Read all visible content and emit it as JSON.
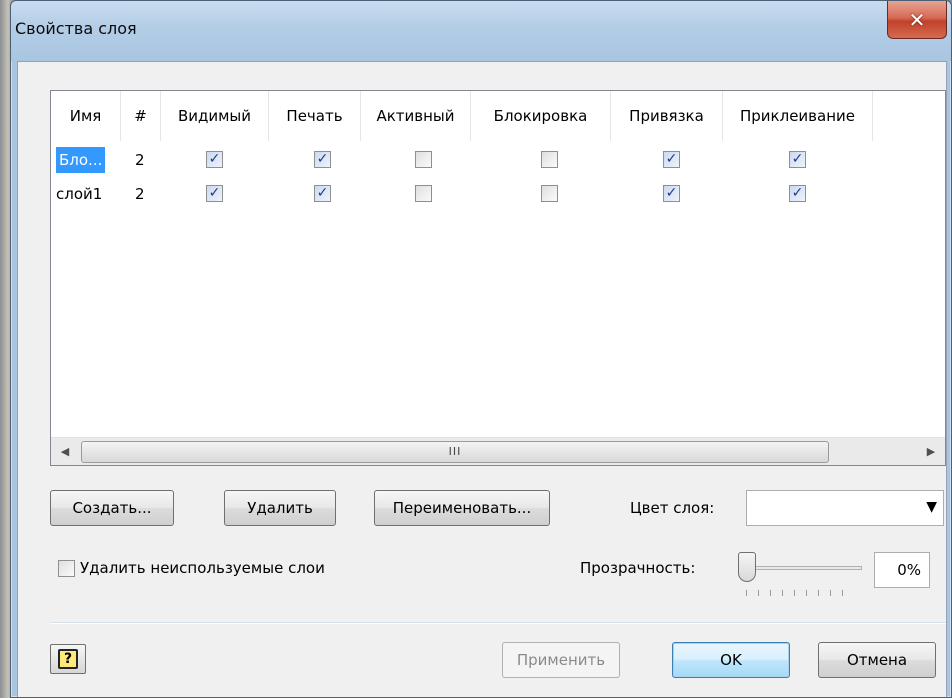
{
  "window": {
    "title": "Свойства слоя",
    "close_glyph": "✕"
  },
  "table": {
    "columns": [
      "Имя",
      "#",
      "Видимый",
      "Печать",
      "Активный",
      "Блокировка",
      "Привязка",
      "Приклеивание"
    ],
    "rows": [
      {
        "name": "Бло...",
        "count": "2",
        "visible": true,
        "print": true,
        "active": false,
        "lock": false,
        "snap": true,
        "glue": true,
        "selected": true
      },
      {
        "name": "слой1",
        "count": "2",
        "visible": true,
        "print": true,
        "active": false,
        "lock": false,
        "snap": true,
        "glue": true,
        "selected": false
      }
    ],
    "scroll_thumb_glyph": "III"
  },
  "buttons": {
    "create": "Создать...",
    "delete": "Удалить",
    "rename": "Переименовать...",
    "apply": "Применить",
    "ok": "OK",
    "cancel": "Отмена"
  },
  "layer_color": {
    "label": "Цвет слоя:",
    "value": ""
  },
  "remove_unused": {
    "label": "Удалить неиспользуемые слои",
    "checked": false
  },
  "transparency": {
    "label": "Прозрачность:",
    "value": "0%"
  },
  "help": {
    "glyph": "?"
  }
}
